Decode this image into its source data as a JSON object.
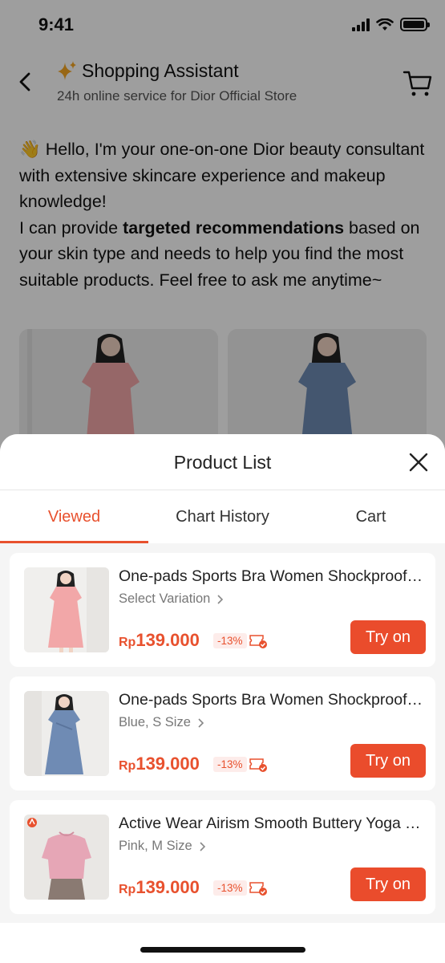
{
  "status_bar": {
    "time": "9:41"
  },
  "header": {
    "title": "Shopping Assistant",
    "subtitle": "24h online service for Dior Official Store"
  },
  "chat": {
    "emoji": "👋",
    "line1": " Hello, I'm your one-on-one Dior beauty consultant with extensive skincare experience and makeup knowledge!",
    "line2_pre": "I can provide ",
    "line2_bold": "targeted recommendations",
    "line2_post": " based on your skin type and needs to help you find the most suitable products. Feel free to ask me anytime~"
  },
  "sheet": {
    "title": "Product List",
    "tabs": [
      {
        "label": "Viewed",
        "active": true
      },
      {
        "label": "Chart History",
        "active": false
      },
      {
        "label": "Cart",
        "active": false
      }
    ]
  },
  "products": [
    {
      "title": "One-pads Sports Bra Women Shockproof Running Fitness",
      "variant": "Select Variation",
      "currency": "Rp",
      "price": "139.000",
      "discount": "-13%",
      "button": "Try on",
      "image": "pink-dress"
    },
    {
      "title": "One-pads Sports Bra Women Shockproof Running Fitness",
      "variant": "Blue, S Size",
      "currency": "Rp",
      "price": "139.000",
      "discount": "-13%",
      "button": "Try on",
      "image": "blue-dress"
    },
    {
      "title": "Active Wear Airism Smooth Buttery Yoga Top",
      "variant": "Pink, M Size",
      "currency": "Rp",
      "price": "139.000",
      "discount": "-13%",
      "button": "Try on",
      "image": "pink-tshirt"
    }
  ],
  "colors": {
    "accent": "#e8512e",
    "button": "#ea4c2c",
    "discount_bg": "#fdecea"
  }
}
